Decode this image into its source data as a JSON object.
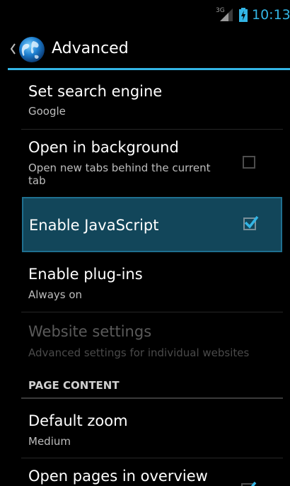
{
  "status_bar": {
    "network_type": "3G",
    "time": "10:13",
    "icons": [
      "signal-icon",
      "battery-charging-icon"
    ],
    "time_color": "#33b5e5"
  },
  "action_bar": {
    "title": "Advanced",
    "icons": [
      "up-chevron-icon",
      "globe-icon"
    ],
    "accent_color": "#33b5e5"
  },
  "preferences": [
    {
      "title": "Set search engine",
      "summary": "Google"
    },
    {
      "title": "Open in background",
      "summary": "Open new tabs behind the current tab",
      "checked": false
    },
    {
      "title": "Enable JavaScript",
      "checked": true,
      "highlighted": true
    },
    {
      "title": "Enable plug-ins",
      "summary": "Always on"
    },
    {
      "title": "Website settings",
      "summary": "Advanced settings for individual websites",
      "enabled": false
    }
  ],
  "section": {
    "header": "PAGE CONTENT"
  },
  "page_content_prefs": [
    {
      "title": "Default zoom",
      "summary": "Medium"
    },
    {
      "title": "Open pages in overview",
      "checked": true
    }
  ]
}
